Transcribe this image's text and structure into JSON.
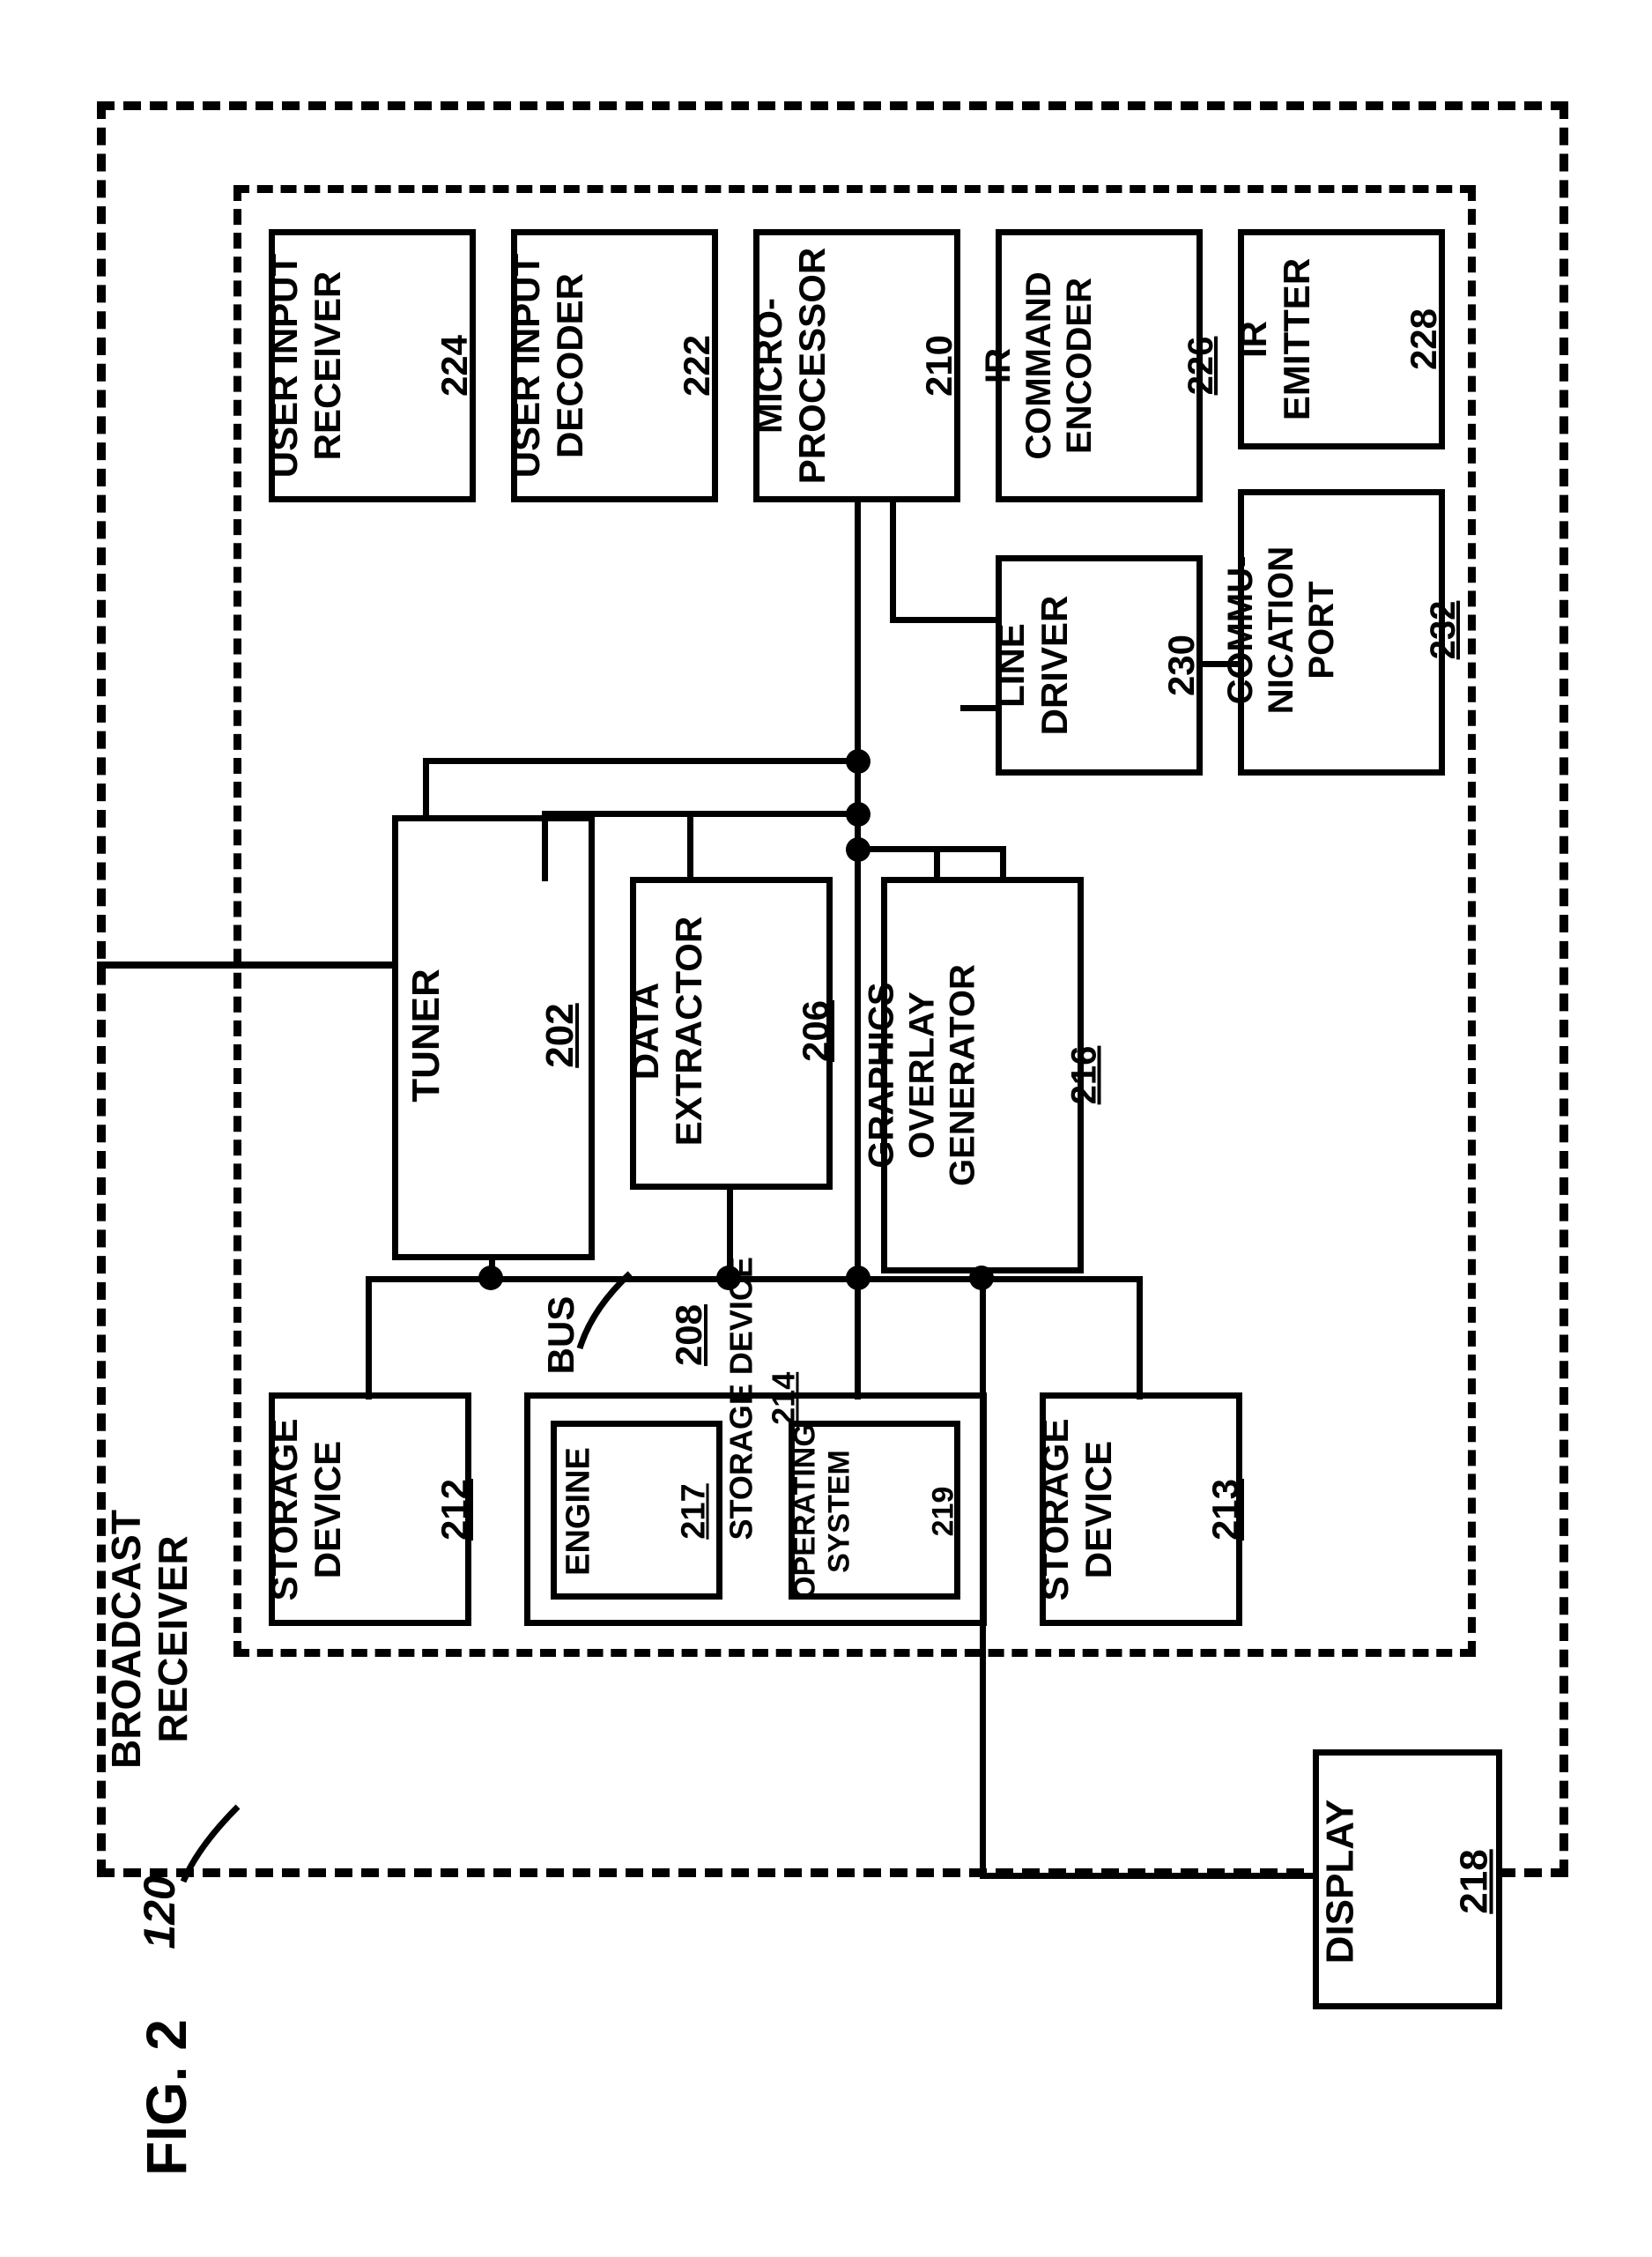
{
  "figure_label": "FIG. 2",
  "outer": {
    "label": "BROADCAST\nRECEIVER",
    "ref": "120"
  },
  "bus": {
    "label": "BUS",
    "ref": "208"
  },
  "blocks": {
    "user_input_receiver": {
      "label": "USER INPUT\nRECEIVER",
      "ref": "224"
    },
    "user_input_decoder": {
      "label": "USER INPUT\nDECODER",
      "ref": "222"
    },
    "micro_processor": {
      "label": "MICRO-\nPROCESSOR",
      "ref": "210"
    },
    "ir_command_encoder": {
      "label": "IR\nCOMMAND\nENCODER",
      "ref": "226"
    },
    "ir_emitter": {
      "label": "IR\nEMITTER",
      "ref": "228"
    },
    "line_driver": {
      "label": "LINE\nDRIVER",
      "ref": "230"
    },
    "communication_port": {
      "label": "COMMU-\nNICATION\nPORT",
      "ref": "232"
    },
    "tuner": {
      "label": "TUNER",
      "ref": "202"
    },
    "data_extractor": {
      "label": "DATA\nEXTRACTOR",
      "ref": "206"
    },
    "graphics_overlay_gen": {
      "label": "GRAPHICS\nOVERLAY\nGENERATOR",
      "ref": "216"
    },
    "display": {
      "label": "DISPLAY",
      "ref": "218"
    },
    "storage_device_212": {
      "label": "STORAGE\nDEVICE",
      "ref": "212"
    },
    "storage_device_213": {
      "label": "STORAGE\nDEVICE",
      "ref": "213"
    },
    "storage_device_214": {
      "label": "STORAGE DEVICE",
      "ref": "214"
    },
    "engine": {
      "label": "ENGINE",
      "ref": "217"
    },
    "operating_system": {
      "label": "OPERATING\nSYSTEM",
      "ref": "219"
    }
  }
}
